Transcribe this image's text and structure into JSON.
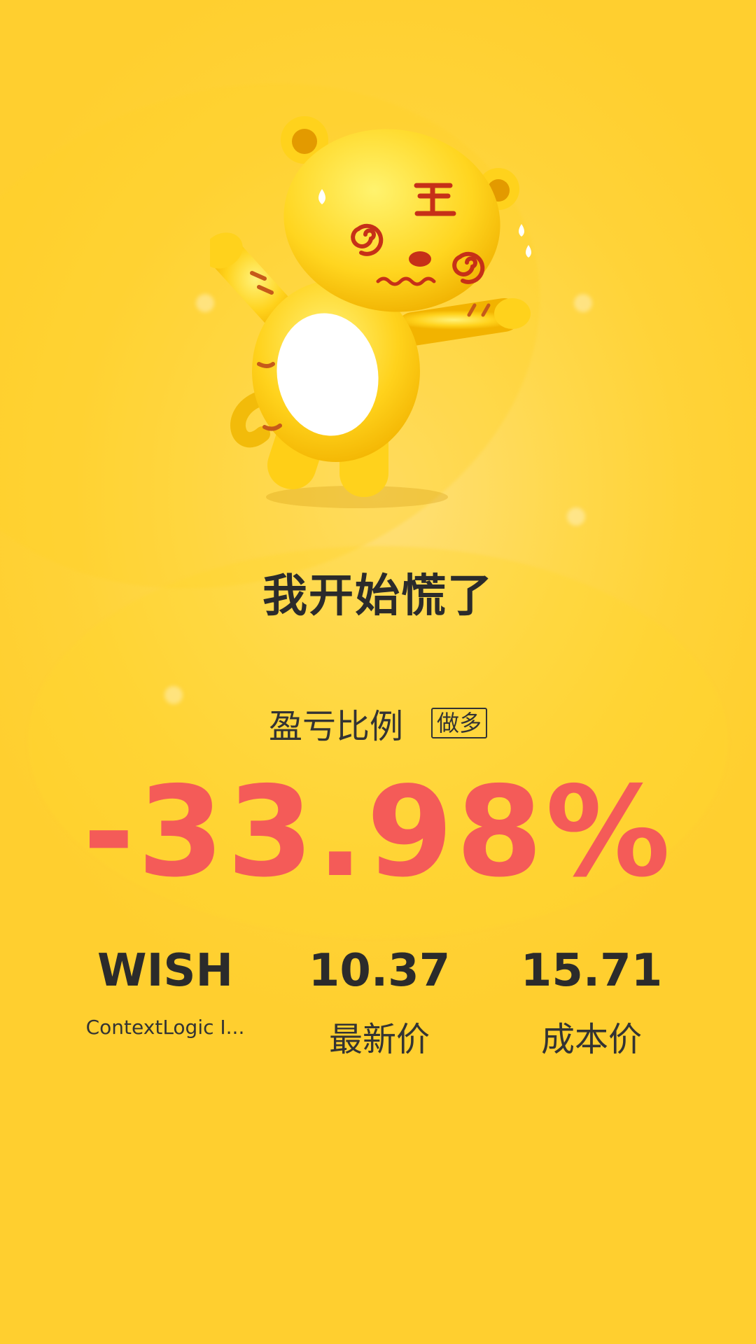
{
  "mood_title": "我开始慌了",
  "ratio": {
    "label": "盈亏比例",
    "position_tag": "做多",
    "value": "-33.98%"
  },
  "stock": {
    "symbol": "WISH",
    "name": "ContextLogic I..."
  },
  "prices": {
    "latest": {
      "value": "10.37",
      "label": "最新价"
    },
    "cost": {
      "value": "15.71",
      "label": "成本价"
    }
  },
  "colors": {
    "background": "#ffd338",
    "loss": "#f45b58",
    "text": "#2b2b2b"
  },
  "mascot": {
    "icon": "panicking-tiger-mascot"
  }
}
